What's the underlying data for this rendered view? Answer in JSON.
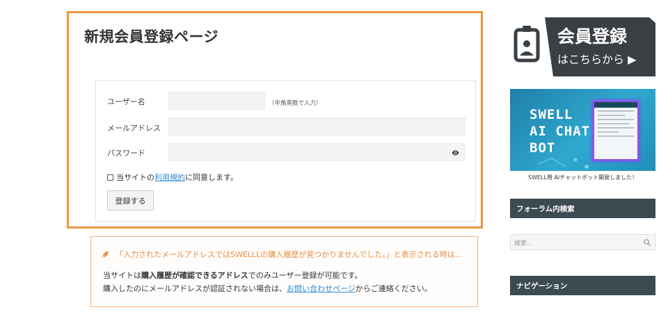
{
  "main": {
    "title": "新規会員登録ページ",
    "form": {
      "username_label": "ユーザー名",
      "username_hint": "（半角英数で入力）",
      "email_label": "メールアドレス",
      "password_label": "パスワード",
      "agree_prefix": "当サイトの",
      "agree_link": "利用規約",
      "agree_suffix": "に同意します。",
      "submit_label": "登録する"
    }
  },
  "notice": {
    "title": "「入力されたメールアドレスではSWELLLの購入履歴が見つかりませんでした。」と表示される時は…",
    "line1_prefix": "当サイトは",
    "line1_bold": "購入履歴が確認できるアドレス",
    "line1_suffix": "でのみユーザー登録が可能です。",
    "line2_prefix": "購入したのにメールアドレスが認証されない場合は、",
    "line2_link": "お問い合わせページ",
    "line2_suffix": "からご連絡ください。"
  },
  "sidebar": {
    "register_banner": {
      "line1": "会員登録",
      "line2": "はこちらから ▶"
    },
    "ai_banner": {
      "line1": "SWELL",
      "line2": "AI CHAT",
      "line3": "BOT",
      "caption": "SWELL用 AIチャットボット開発しました！"
    },
    "forum_search_title": "フォーラム内検索",
    "search_placeholder": "検索…",
    "navigation_title": "ナビゲーション"
  },
  "colors": {
    "accent_orange": "#f0953f",
    "link_blue": "#2e8ad8",
    "widget_dark": "#3c4a52"
  }
}
